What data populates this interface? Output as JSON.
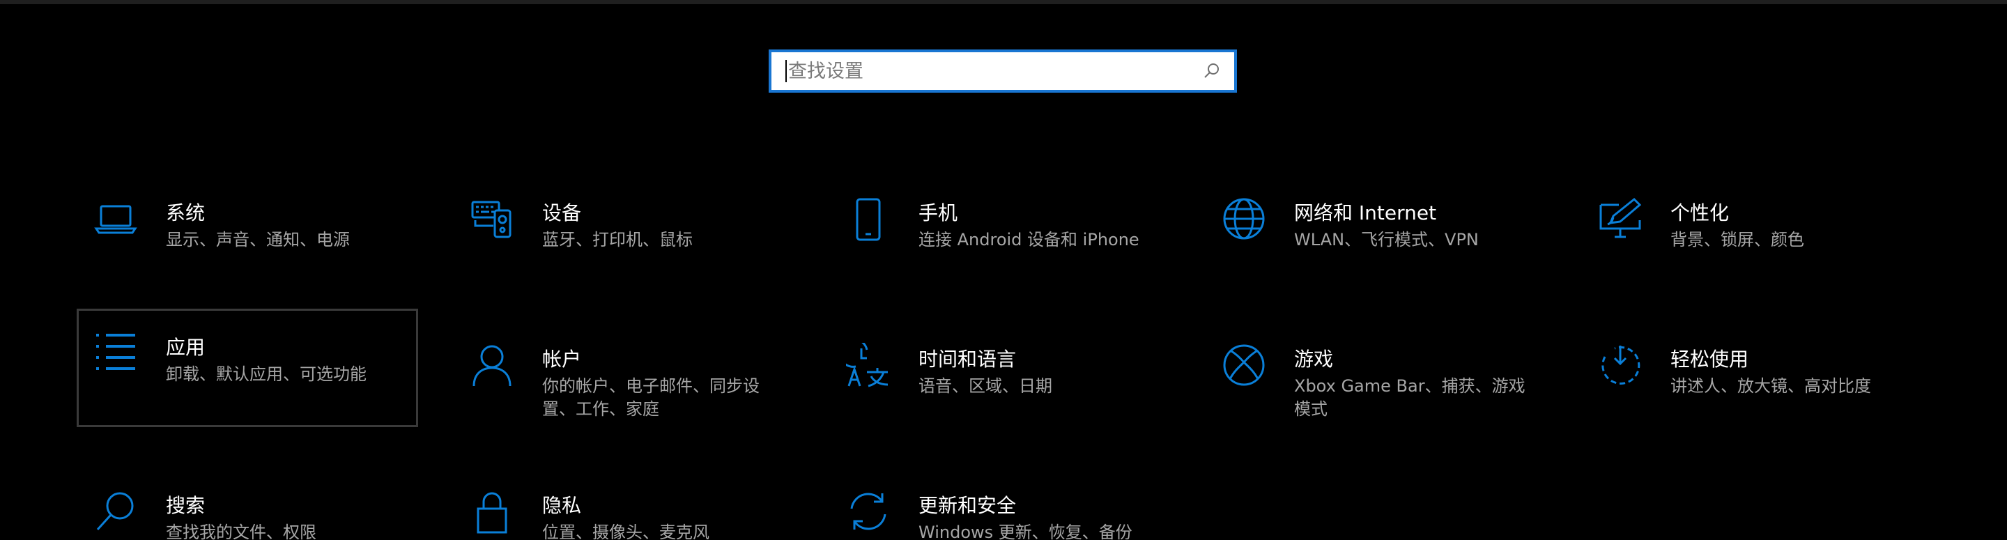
{
  "search": {
    "placeholder": "查找设置"
  },
  "colors": {
    "accent": "#1976d2",
    "icon": "#0a7fd8",
    "background": "#000000"
  },
  "tiles": [
    {
      "title": "系统",
      "subtitle": "显示、声音、通知、电源",
      "icon": "laptop-icon"
    },
    {
      "title": "设备",
      "subtitle": "蓝牙、打印机、鼠标",
      "icon": "devices-icon"
    },
    {
      "title": "手机",
      "subtitle": "连接 Android 设备和 iPhone",
      "icon": "phone-icon"
    },
    {
      "title": "网络和 Internet",
      "subtitle": "WLAN、飞行模式、VPN",
      "icon": "globe-icon"
    },
    {
      "title": "个性化",
      "subtitle": "背景、锁屏、颜色",
      "icon": "personalize-icon"
    },
    {
      "title": "应用",
      "subtitle": "卸载、默认应用、可选功能",
      "icon": "apps-icon"
    },
    {
      "title": "帐户",
      "subtitle": "你的帐户、电子邮件、同步设置、工作、家庭",
      "icon": "account-icon"
    },
    {
      "title": "时间和语言",
      "subtitle": "语音、区域、日期",
      "icon": "time-language-icon"
    },
    {
      "title": "游戏",
      "subtitle": "Xbox Game Bar、捕获、游戏模式",
      "icon": "xbox-icon"
    },
    {
      "title": "轻松使用",
      "subtitle": "讲述人、放大镜、高对比度",
      "icon": "ease-of-access-icon"
    },
    {
      "title": "搜索",
      "subtitle": "查找我的文件、权限",
      "icon": "search-icon"
    },
    {
      "title": "隐私",
      "subtitle": "位置、摄像头、麦克风",
      "icon": "lock-icon"
    },
    {
      "title": "更新和安全",
      "subtitle": "Windows 更新、恢复、备份",
      "icon": "update-icon"
    }
  ]
}
